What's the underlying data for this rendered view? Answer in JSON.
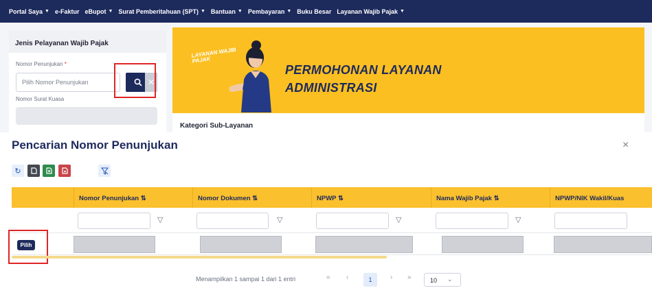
{
  "nav": {
    "items": [
      {
        "label": "Portal Saya",
        "caret": true
      },
      {
        "label": "e-Faktur",
        "caret": false
      },
      {
        "label": "eBupot",
        "caret": true
      },
      {
        "label": "Surat Pemberitahuan (SPT)",
        "caret": true
      },
      {
        "label": "Bantuan",
        "caret": true
      },
      {
        "label": "Pembayaran",
        "caret": true
      },
      {
        "label": "Buku Besar",
        "caret": false
      },
      {
        "label": "Layanan Wajib Pajak",
        "caret": true
      }
    ]
  },
  "left_panel": {
    "title": "Jenis Pelayanan Wajib Pajak",
    "nomor_penunjukan_label": "Nomor Penunjukan",
    "required_mark": "*",
    "nomor_penunjukan_placeholder": "Pilih Nomor Penunjukan",
    "nomor_surat_kuasa_label": "Nomor Surat Kuasa"
  },
  "banner": {
    "tag": "LAYANAN WAJIB PAJAK",
    "line1": "PERMOHONAN LAYANAN",
    "line2": "ADMINISTRASI"
  },
  "kategori_label": "Kategori Sub-Layanan",
  "modal": {
    "title": "Pencarian Nomor Penunjukan",
    "close": "×",
    "toolbar": [
      "refresh-icon",
      "file-icon",
      "excel-icon",
      "pdf-icon",
      "clear-filter-icon"
    ],
    "columns": [
      "",
      "Nomor Penunjukan ⇅",
      "Nomor Dokumen ⇅",
      "NPWP ⇅",
      "Nama Wajib Pajak ⇅",
      "NPWP/NIK Wakil/Kuas"
    ],
    "pilih_label": "Pilih",
    "pager": {
      "info": "Menampilkan 1 sampai 1 dari 1 entri",
      "first": "«",
      "prev": "‹",
      "current_page": "1",
      "next": "›",
      "last": "»",
      "page_size": "10"
    }
  },
  "colors": {
    "navy": "#1d2a5c",
    "yellow": "#fbc02d",
    "highlight": "#e02424"
  }
}
